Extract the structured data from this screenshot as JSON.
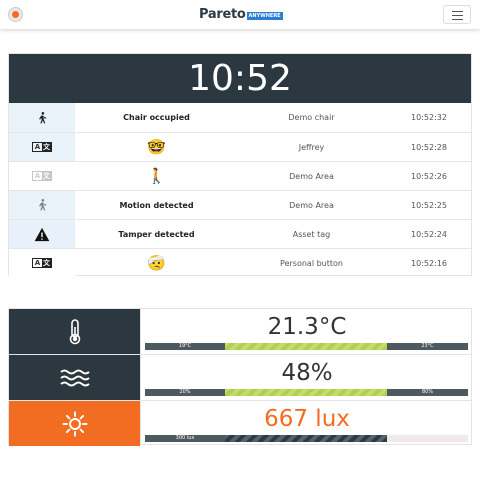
{
  "header": {
    "brand": "Pareto",
    "brand_badge": "ANYWHERE"
  },
  "clock": {
    "time": "10:52"
  },
  "events": [
    {
      "icon": "walking-person-icon",
      "name": "Chair occupied",
      "device": "Demo chair",
      "time": "10:52:32"
    },
    {
      "icon": "nerd-face-emoji",
      "name": "🤓",
      "device": "Jeffrey",
      "time": "10:52:28"
    },
    {
      "icon": "person-walking-emoji",
      "name": "🚶",
      "device": "Demo Area",
      "time": "10:52:26"
    },
    {
      "icon": "walking-person-icon",
      "name": "Motion detected",
      "device": "Demo Area",
      "time": "10:52:25"
    },
    {
      "icon": "warning-triangle-icon",
      "name": "Tamper detected",
      "device": "Asset tag",
      "time": "10:52:24"
    },
    {
      "icon": "bandaged-face-emoji",
      "name": "🤕",
      "device": "Personal button",
      "time": "10:52:16"
    }
  ],
  "sensors": [
    {
      "icon": "thermometer-icon",
      "value": "21.3°C",
      "color": "#2c383f",
      "bar": {
        "low_label": "19°C",
        "high_label": "23°C",
        "level": 0.213
      }
    },
    {
      "icon": "humidity-waves-icon",
      "value": "48%",
      "color": "#2c383f",
      "bar": {
        "low_label": "20%",
        "high_label": "80%",
        "level": 0.48
      }
    },
    {
      "icon": "sun-icon",
      "value": "667 lux",
      "color": "#f26d21",
      "bar": {
        "low_label": "300 lux",
        "level": 0.667
      }
    }
  ],
  "colors": {
    "dark": "#2c383f",
    "accent": "#f26d21",
    "ok_green": "#b3cf52"
  }
}
